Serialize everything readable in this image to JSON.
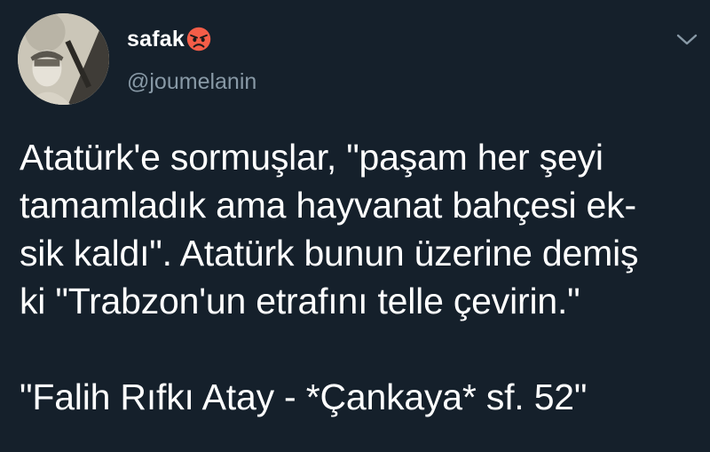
{
  "user": {
    "display_name": "safak",
    "emoji": "angry-face-icon",
    "handle": "@joumelanin"
  },
  "tweet": {
    "lines": [
      "Atatürk'e sormuşlar, \"paşam her şeyi",
      "tamamladık ama hayvanat bahçesi ek-",
      "sik kaldı\". Atatürk bunun üzerine demiş",
      "ki \"Trabzon'un etrafını telle çevirin.\""
    ],
    "quote": "\"Falih Rıfkı Atay - *Çankaya* sf. 52\""
  },
  "colors": {
    "background": "#15202b",
    "text": "#ffffff",
    "secondary_text": "#8899a6",
    "emoji_face": "#f45d48"
  }
}
